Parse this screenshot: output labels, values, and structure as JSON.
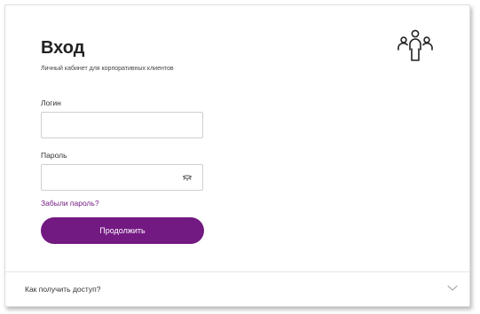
{
  "login_form": {
    "title": "Вход",
    "subtitle": "Личный кабинет для корпоративных клиентов",
    "login_label": "Логин",
    "login_value": "",
    "password_label": "Пароль",
    "password_value": "",
    "forgot_link": "Забыли пароль?",
    "submit_label": "Продолжить"
  },
  "access_section": {
    "label": "Как получить доступ?"
  },
  "icons": {
    "header": "people-group-icon",
    "password_toggle": "eye-closed-icon",
    "expand": "chevron-down-icon"
  },
  "colors": {
    "accent": "#731982",
    "text": "#222222",
    "border": "#cfcfcf"
  }
}
